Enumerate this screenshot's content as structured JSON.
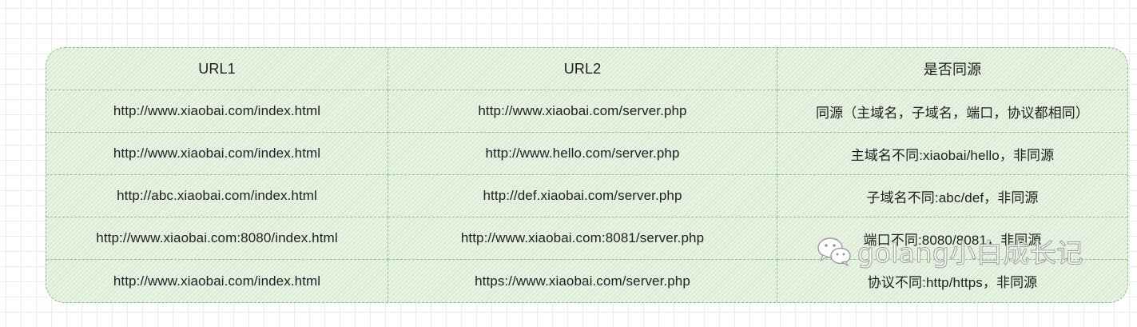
{
  "table": {
    "headers": [
      "URL1",
      "URL2",
      "是否同源"
    ],
    "rows": [
      [
        "http://www.xiaobai.com/index.html",
        "http://www.xiaobai.com/server.php",
        "同源（主域名，子域名，端口，协议都相同）"
      ],
      [
        "http://www.xiaobai.com/index.html",
        "http://www.hello.com/server.php",
        "主域名不同:xiaobai/hello，非同源"
      ],
      [
        "http://abc.xiaobai.com/index.html",
        "http://def.xiaobai.com/server.php",
        "子域名不同:abc/def，非同源"
      ],
      [
        "http://www.xiaobai.com:8080/index.html",
        "http://www.xiaobai.com:8081/server.php",
        "端口不同:8080/8081，非同源"
      ],
      [
        "http://www.xiaobai.com/index.html",
        "https://www.xiaobai.com/server.php",
        "协议不同:http/https，非同源"
      ]
    ]
  },
  "watermark": {
    "icon": "wechat-icon",
    "text": "golang小白成长记"
  },
  "colors": {
    "table_fill": "#e8f3e3",
    "table_border": "#7fc07a",
    "grid_line": "#ececec"
  }
}
